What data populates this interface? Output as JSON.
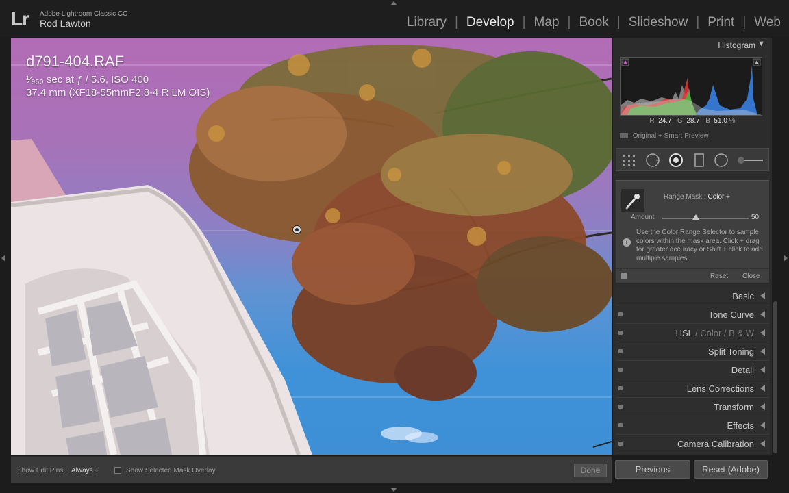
{
  "app": {
    "logo": "Lr",
    "name": "Adobe Lightroom Classic CC",
    "user": "Rod Lawton"
  },
  "modules": [
    "Library",
    "Develop",
    "Map",
    "Book",
    "Slideshow",
    "Print",
    "Web"
  ],
  "active_module": "Develop",
  "image_info": {
    "filename": "d791-404.RAF",
    "exposure": "¹⁄₉₅₀ sec at ƒ / 5.6, ISO 400",
    "lens": "37.4 mm (XF18-55mmF2.8-4 R LM OIS)"
  },
  "toolbar": {
    "edit_pins_label": "Show Edit Pins :",
    "edit_pins_value": "Always ÷",
    "mask_overlay_label": "Show Selected Mask Overlay",
    "done_label": "Done"
  },
  "histogram": {
    "title": "Histogram",
    "expand_glyph": "▼",
    "r_label": "R",
    "r_value": "24.7",
    "g_label": "G",
    "g_value": "28.7",
    "b_label": "B",
    "b_value": "51.0",
    "percent": "%",
    "preview_label": "Original + Smart Preview"
  },
  "mask": {
    "range_mask_label": "Range Mask :",
    "range_mask_value": "Color ÷",
    "amount_label": "Amount",
    "amount_value": "50",
    "amount": 50,
    "info_glyph": "i",
    "help": "Use the Color Range Selector to sample colors within the mask area. Click + drag for greater accuracy or Shift + click to add multiple samples.",
    "reset": "Reset",
    "close": "Close"
  },
  "sections": [
    {
      "title": "Basic",
      "switch": false
    },
    {
      "title": "Tone Curve",
      "switch": true
    },
    {
      "title": "HSL",
      "title2": " / Color / B & W",
      "switch": true
    },
    {
      "title": "Split Toning",
      "switch": true
    },
    {
      "title": "Detail",
      "switch": true
    },
    {
      "title": "Lens Corrections",
      "switch": true
    },
    {
      "title": "Transform",
      "switch": true
    },
    {
      "title": "Effects",
      "switch": true
    },
    {
      "title": "Camera Calibration",
      "switch": true
    }
  ],
  "buttons": {
    "previous": "Previous",
    "reset": "Reset (Adobe)"
  },
  "colors": {
    "accent": "#e6e6e6",
    "panel_bg": "#2c2c2c",
    "histogram_blue": "#3a7fe0",
    "histogram_red": "#e03a3a",
    "histogram_green": "#3ac03a"
  }
}
